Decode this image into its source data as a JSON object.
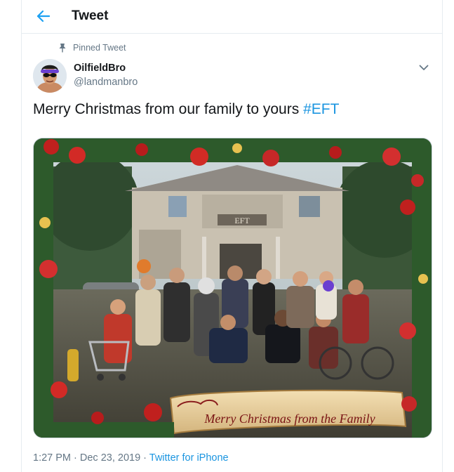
{
  "header": {
    "title": "Tweet",
    "back_icon": "arrow-left-icon"
  },
  "tweet": {
    "pinned_label": "Pinned Tweet",
    "author": {
      "name": "OilfieldBro",
      "handle": "@landmanbro"
    },
    "text": "Merry Christmas from our family to yours",
    "hashtag": "#EFT",
    "media": {
      "banner_text": "Merry Christmas from the Family",
      "house_sign": "EFT"
    },
    "timestamp": "1:27 PM · Dec 23, 2019 ·",
    "source": "Twitter for iPhone"
  },
  "colors": {
    "accent": "#1b95e0",
    "secondary_text": "#657786",
    "border": "#e6ecf0"
  }
}
